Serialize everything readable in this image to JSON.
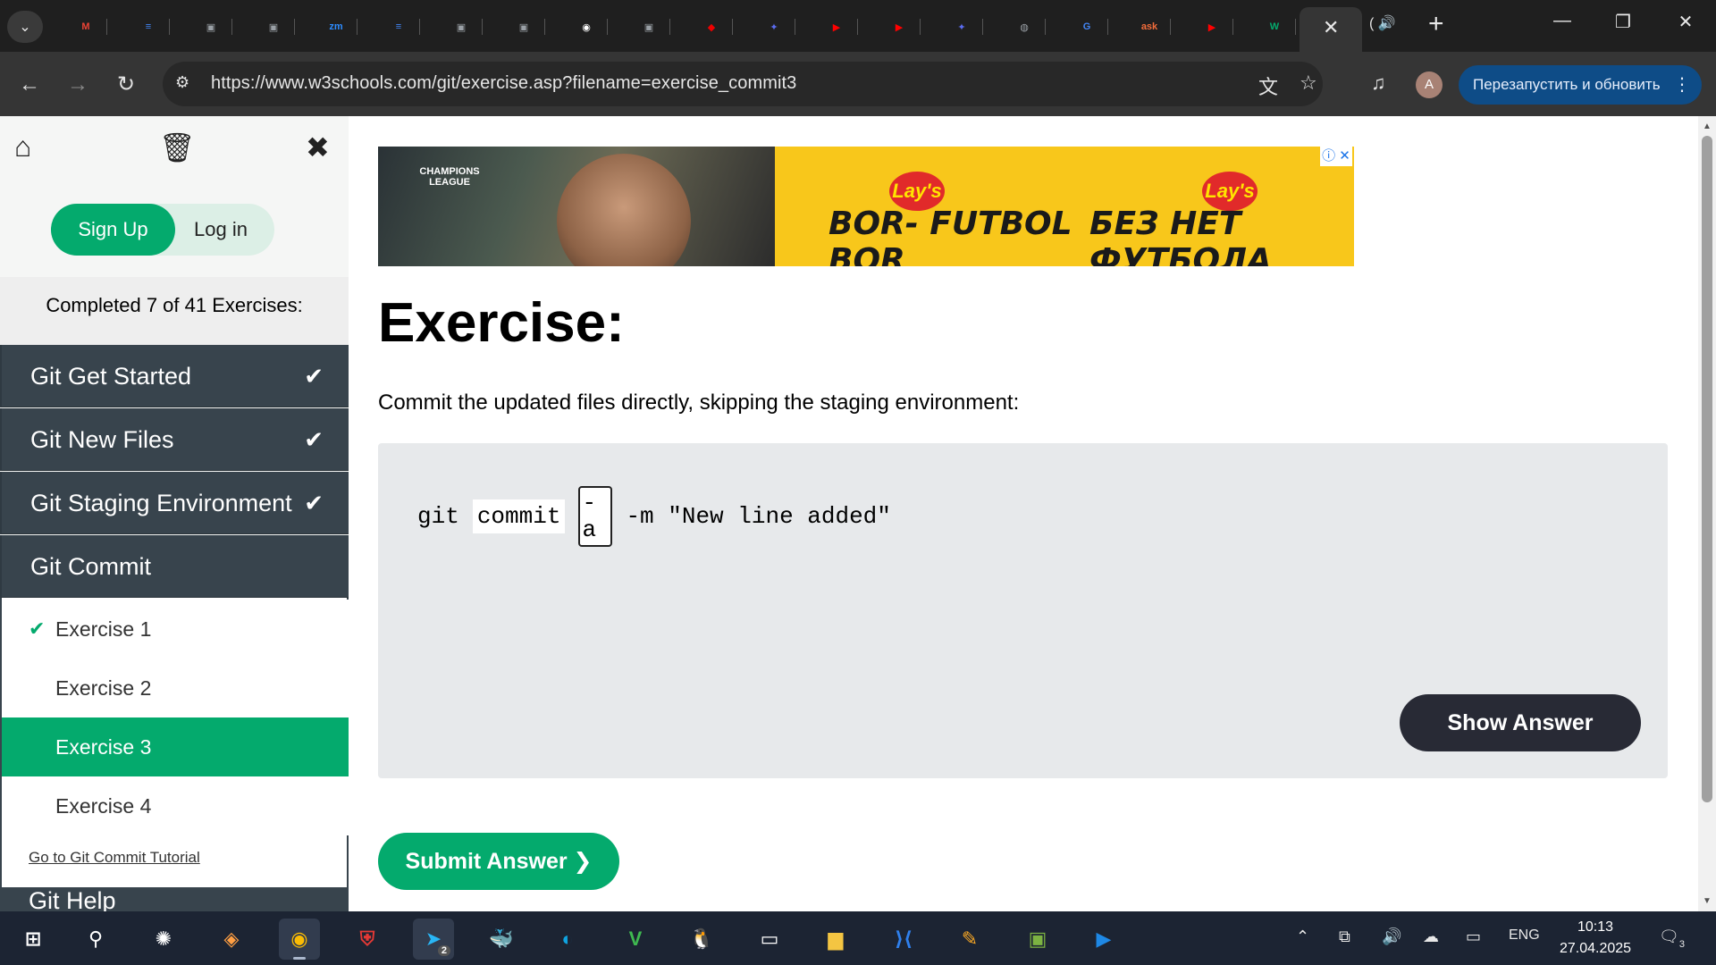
{
  "browser": {
    "url": "https://www.w3schools.com/git/exercise.asp?filename=exercise_commit3",
    "relaunch_label": "Перезапустить и обновить",
    "profile_initial": "A",
    "tabs": [
      {
        "icon": "gmail-icon",
        "glyph": "M",
        "color": "#ea4335"
      },
      {
        "icon": "docs-icon",
        "glyph": "≡",
        "color": "#4285f4"
      },
      {
        "icon": "contact-card-icon",
        "glyph": "▣",
        "color": "#9aa0a6"
      },
      {
        "icon": "contact-card-icon",
        "glyph": "▣",
        "color": "#9aa0a6"
      },
      {
        "icon": "zoom-icon",
        "glyph": "zm",
        "color": "#2d8cff"
      },
      {
        "icon": "docs-icon",
        "glyph": "≡",
        "color": "#4285f4"
      },
      {
        "icon": "contact-card-icon",
        "glyph": "▣",
        "color": "#9aa0a6"
      },
      {
        "icon": "contact-card-icon",
        "glyph": "▣",
        "color": "#9aa0a6"
      },
      {
        "icon": "github-icon",
        "glyph": "◉",
        "color": "#ffffff"
      },
      {
        "icon": "contact-card-icon",
        "glyph": "▣",
        "color": "#9aa0a6"
      },
      {
        "icon": "redhat-icon",
        "glyph": "◆",
        "color": "#ee0000"
      },
      {
        "icon": "stepik-icon",
        "glyph": "✦",
        "color": "#5b6cf0"
      },
      {
        "icon": "youtube-icon",
        "glyph": "▶",
        "color": "#ff0000"
      },
      {
        "icon": "youtube-icon",
        "glyph": "▶",
        "color": "#ff0000"
      },
      {
        "icon": "stepik-icon",
        "glyph": "✦",
        "color": "#5b6cf0"
      },
      {
        "icon": "globe-icon",
        "glyph": "◍",
        "color": "#9aa0a6"
      },
      {
        "icon": "google-translate-icon",
        "glyph": "G",
        "color": "#4285f4"
      },
      {
        "icon": "ask-icon",
        "glyph": "ask",
        "color": "#f26c3b"
      },
      {
        "icon": "youtube-icon",
        "glyph": "▶",
        "color": "#ff0000"
      },
      {
        "icon": "w3schools-icon",
        "glyph": "W",
        "color": "#04aa6d"
      }
    ]
  },
  "sidebar": {
    "signup_label": "Sign Up",
    "login_label": "Log in",
    "progress_text": "Completed 7 of 41 Exercises:",
    "sections": [
      {
        "label": "Git Get Started",
        "done": true
      },
      {
        "label": "Git New Files",
        "done": true
      },
      {
        "label": "Git Staging Environment",
        "done": true
      },
      {
        "label": "Git Commit",
        "done": false
      }
    ],
    "exercises": [
      {
        "label": "Exercise 1",
        "done": true,
        "active": false
      },
      {
        "label": "Exercise 2",
        "done": false,
        "active": false
      },
      {
        "label": "Exercise 3",
        "done": false,
        "active": true
      },
      {
        "label": "Exercise 4",
        "done": false,
        "active": false
      }
    ],
    "tutorial_link": "Go to Git Commit Tutorial",
    "next_section_partial": "Git Help"
  },
  "ad": {
    "league_label": "CHAMPIONS LEAGUE",
    "brand": "Lay's",
    "slogan_left": "BOR- FUTBOL BOR",
    "slogan_right": "БЕЗ НЕТ ФУТБОЛА",
    "adchoices": "ⓘ ✕"
  },
  "exercise": {
    "title": "Exercise:",
    "description": "Commit the updated files directly, skipping the staging environment:",
    "code": {
      "prefix": "git",
      "word1": "commit",
      "answer_value": "-a",
      "suffix": "-m \"New line added\""
    },
    "show_answer_label": "Show Answer",
    "submit_label": "Submit Answer ❯"
  },
  "taskbar": {
    "time": "10:13",
    "date": "27.04.2025",
    "language": "ENG",
    "notification_count": "3",
    "telegram_badge": "2"
  }
}
